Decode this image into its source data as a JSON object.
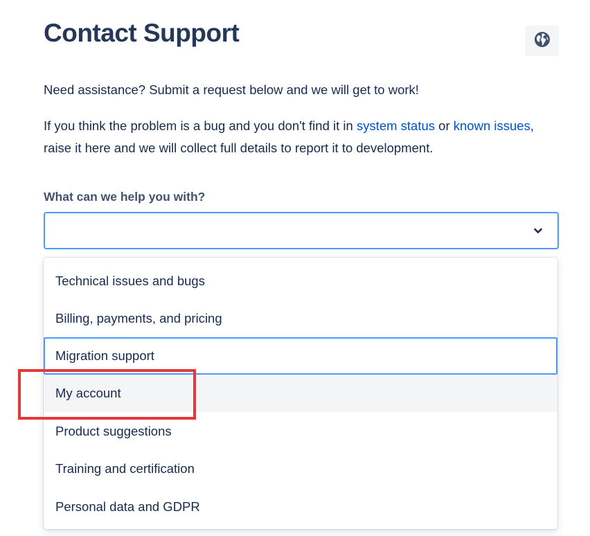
{
  "page": {
    "title": "Contact Support",
    "language_icon": "globe-icon"
  },
  "intro": {
    "text": "Need assistance? Submit a request below and we will get to work!"
  },
  "bug_notice": {
    "before": "If you think the problem is a bug and you don't find it in ",
    "link_system_status": "system status",
    "middle": " or ",
    "link_known_issues": "known issues",
    "after": ", raise it here and we will collect full details to report it to development."
  },
  "request_type": {
    "label": "What can we help you with?",
    "selected_value": "",
    "icon": "chevron-down-icon",
    "options": [
      "Technical issues and bugs",
      "Billing, payments, and pricing",
      "Migration support",
      "My account",
      "Product suggestions",
      "Training and certification",
      "Personal data and GDPR"
    ],
    "focused_option": "Migration support",
    "hovered_option": "My account"
  },
  "colors": {
    "focus_ring": "#4c9aff",
    "link": "#0052cc",
    "highlight_annotation": "#e5383b",
    "hover_background": "#f4f5f7"
  }
}
